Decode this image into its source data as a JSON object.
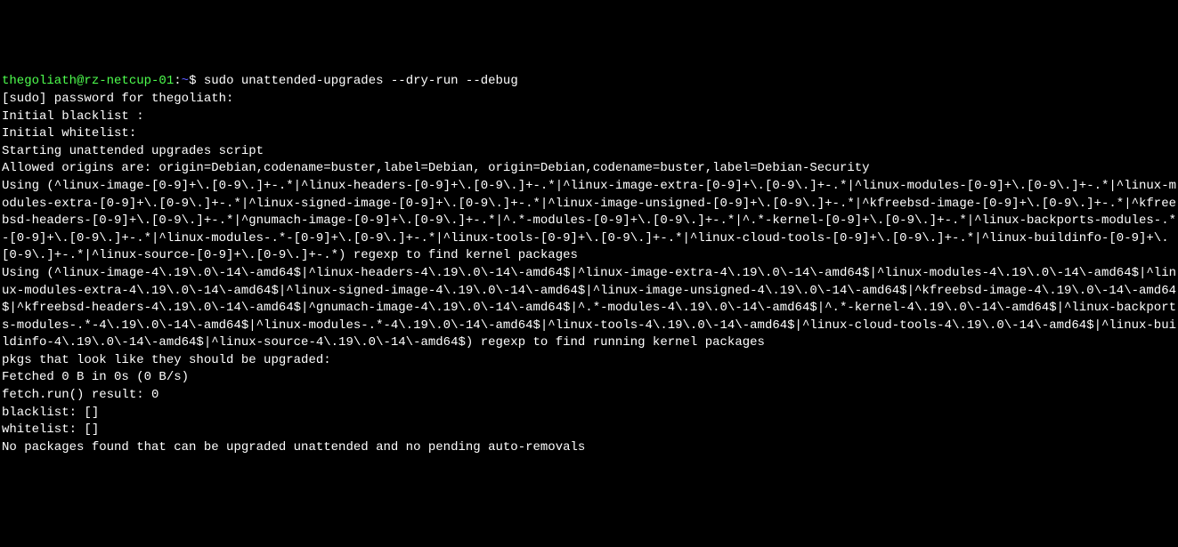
{
  "prompt": {
    "user": "thegoliath",
    "at": "@",
    "host": "rz-netcup-01",
    "colon": ":",
    "path": "~",
    "dollar": "$ ",
    "command": "sudo unattended-upgrades --dry-run --debug"
  },
  "lines": {
    "l1": "[sudo] password for thegoliath:",
    "l2": "Initial blacklist :",
    "l3": "Initial whitelist:",
    "l4": "Starting unattended upgrades script",
    "l5": "Allowed origins are: origin=Debian,codename=buster,label=Debian, origin=Debian,codename=buster,label=Debian-Security",
    "l6": "Using (^linux-image-[0-9]+\\.[0-9\\.]+-.*|^linux-headers-[0-9]+\\.[0-9\\.]+-.*|^linux-image-extra-[0-9]+\\.[0-9\\.]+-.*|^linux-modules-[0-9]+\\.[0-9\\.]+-.*|^linux-modules-extra-[0-9]+\\.[0-9\\.]+-.*|^linux-signed-image-[0-9]+\\.[0-9\\.]+-.*|^linux-image-unsigned-[0-9]+\\.[0-9\\.]+-.*|^kfreebsd-image-[0-9]+\\.[0-9\\.]+-.*|^kfreebsd-headers-[0-9]+\\.[0-9\\.]+-.*|^gnumach-image-[0-9]+\\.[0-9\\.]+-.*|^.*-modules-[0-9]+\\.[0-9\\.]+-.*|^.*-kernel-[0-9]+\\.[0-9\\.]+-.*|^linux-backports-modules-.*-[0-9]+\\.[0-9\\.]+-.*|^linux-modules-.*-[0-9]+\\.[0-9\\.]+-.*|^linux-tools-[0-9]+\\.[0-9\\.]+-.*|^linux-cloud-tools-[0-9]+\\.[0-9\\.]+-.*|^linux-buildinfo-[0-9]+\\.[0-9\\.]+-.*|^linux-source-[0-9]+\\.[0-9\\.]+-.*) regexp to find kernel packages",
    "l7": "Using (^linux-image-4\\.19\\.0\\-14\\-amd64$|^linux-headers-4\\.19\\.0\\-14\\-amd64$|^linux-image-extra-4\\.19\\.0\\-14\\-amd64$|^linux-modules-4\\.19\\.0\\-14\\-amd64$|^linux-modules-extra-4\\.19\\.0\\-14\\-amd64$|^linux-signed-image-4\\.19\\.0\\-14\\-amd64$|^linux-image-unsigned-4\\.19\\.0\\-14\\-amd64$|^kfreebsd-image-4\\.19\\.0\\-14\\-amd64$|^kfreebsd-headers-4\\.19\\.0\\-14\\-amd64$|^gnumach-image-4\\.19\\.0\\-14\\-amd64$|^.*-modules-4\\.19\\.0\\-14\\-amd64$|^.*-kernel-4\\.19\\.0\\-14\\-amd64$|^linux-backports-modules-.*-4\\.19\\.0\\-14\\-amd64$|^linux-modules-.*-4\\.19\\.0\\-14\\-amd64$|^linux-tools-4\\.19\\.0\\-14\\-amd64$|^linux-cloud-tools-4\\.19\\.0\\-14\\-amd64$|^linux-buildinfo-4\\.19\\.0\\-14\\-amd64$|^linux-source-4\\.19\\.0\\-14\\-amd64$) regexp to find running kernel packages",
    "l8": "pkgs that look like they should be upgraded:",
    "l9": "Fetched 0 B in 0s (0 B/s)",
    "l10": "fetch.run() result: 0",
    "l11": "blacklist: []",
    "l12": "whitelist: []",
    "l13": "No packages found that can be upgraded unattended and no pending auto-removals"
  }
}
